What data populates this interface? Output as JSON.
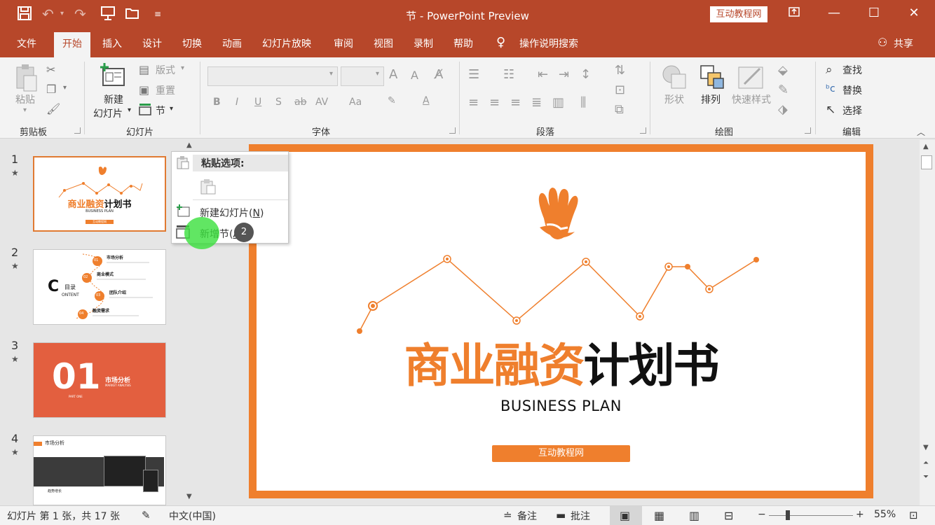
{
  "titlebar": {
    "title": "节  -  PowerPoint Preview",
    "brand_badge": "互动教程网",
    "quick_access": [
      "save-icon",
      "undo-icon",
      "redo-icon",
      "present-icon",
      "open-icon",
      "customize-icon"
    ],
    "window_controls": [
      "restore-ribbon-icon",
      "minimize-icon",
      "maximize-icon",
      "close-icon"
    ]
  },
  "tabs": {
    "items": [
      "文件",
      "开始",
      "插入",
      "设计",
      "切换",
      "动画",
      "幻灯片放映",
      "审阅",
      "视图",
      "录制",
      "帮助",
      "操作说明搜索"
    ],
    "active": "开始",
    "share": "共享"
  },
  "ribbon": {
    "clipboard": {
      "group": "剪贴板",
      "paste": "粘贴"
    },
    "slides": {
      "group": "幻灯片",
      "new_slide_1": "新建",
      "new_slide_2": "幻灯片",
      "layout": "版式",
      "reset": "重置",
      "section": "节"
    },
    "font": {
      "group": "字体",
      "bold": "B",
      "italic": "I",
      "underline": "U",
      "shadow": "S",
      "strike": "ab",
      "spacing": "AV",
      "case": "Aa",
      "grow": "A",
      "shrink": "A",
      "color_a": "A"
    },
    "paragraph": {
      "group": "段落"
    },
    "drawing": {
      "group": "绘图",
      "shapes": "形状",
      "arrange": "排列",
      "quick_styles": "快速样式"
    },
    "editing": {
      "group": "编辑",
      "find": "查找",
      "replace": "替换",
      "select": "选择"
    }
  },
  "slides_pane": {
    "slides": [
      {
        "num": "1",
        "star": "★",
        "title_orange": "商业融资",
        "title_dark": "计划书",
        "sub": "BUSINESS PLAN",
        "button": "互动教程网"
      },
      {
        "num": "2",
        "star": "★",
        "letter": "C",
        "toc": "目录",
        "toc_en": "ONTENT",
        "items": [
          {
            "n": "01",
            "label": "市场分析"
          },
          {
            "n": "02",
            "label": "商业模式"
          },
          {
            "n": "03",
            "label": "团队介绍"
          },
          {
            "n": "04",
            "label": "融资需求"
          }
        ]
      },
      {
        "num": "3",
        "star": "★",
        "big": "01",
        "label": "市场分析",
        "sub": "MARKET ANALYSIS",
        "part": "PART ONE"
      },
      {
        "num": "4",
        "star": "★",
        "header": "市场分析",
        "caption": "趋势增长"
      }
    ]
  },
  "context_menu": {
    "header": "粘贴选项:",
    "new_slide": "新建幻灯片(",
    "new_slide_key": "N",
    "new_slide_close": ")",
    "add_section": "新增节(",
    "add_section_key": "A",
    "step_badge": "2"
  },
  "main_slide": {
    "title_orange": "商业融资",
    "title_dark": "计划书",
    "subtitle": "BUSINESS PLAN",
    "button": "互动教程网",
    "border_color": "#ef7f2d",
    "accent_color": "#f08030"
  },
  "statusbar": {
    "slide_info": "幻灯片 第 1 张，共 17 张",
    "language": "中文(中国)",
    "notes": "备注",
    "comments": "批注",
    "zoom": "55%",
    "zoom_minus": "−",
    "zoom_plus": "+"
  }
}
